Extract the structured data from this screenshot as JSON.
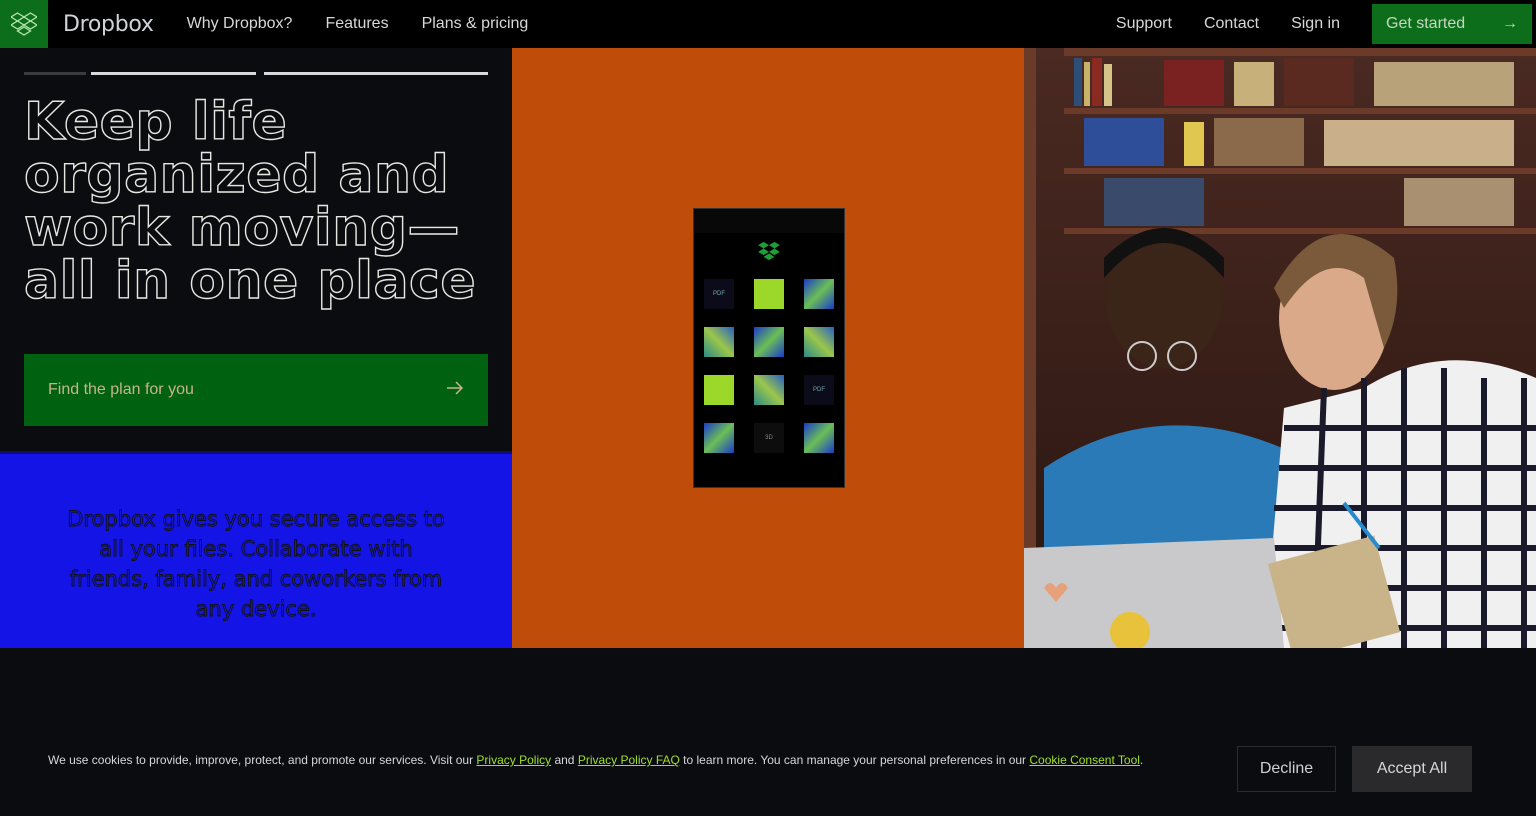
{
  "nav": {
    "brand": "Dropbox",
    "links": [
      "Why Dropbox?",
      "Features",
      "Plans & pricing"
    ],
    "right_links": [
      "Support",
      "Contact",
      "Sign in"
    ],
    "cta_label": "Get started"
  },
  "hero": {
    "headline": "Keep life organized and work moving—all in one place",
    "cta_label": "Find the plan for you",
    "description": "Dropbox gives you secure access to all your files. Collaborate with friends, family, and coworkers from any device."
  },
  "phone": {
    "tiles": [
      "PDF",
      "",
      "",
      "",
      "",
      "",
      "",
      "",
      "PDF",
      "",
      "3D",
      ""
    ]
  },
  "cookie": {
    "text_before": "We use cookies to provide, improve, protect, and promote our services. Visit our ",
    "privacy_policy": "Privacy Policy",
    "and": " and ",
    "privacy_faq": "Privacy Policy FAQ",
    "text_middle": " to learn more. You can manage your personal preferences in our ",
    "consent_tool": "Cookie Consent Tool",
    "text_end": ".",
    "decline_label": "Decline",
    "accept_label": "Accept All"
  },
  "colors": {
    "brand_green": "#0c6e1a",
    "cta_green": "#006110",
    "blue_panel": "#1414e6",
    "orange_panel": "#c04c0a",
    "link_green": "#9fe02a"
  }
}
